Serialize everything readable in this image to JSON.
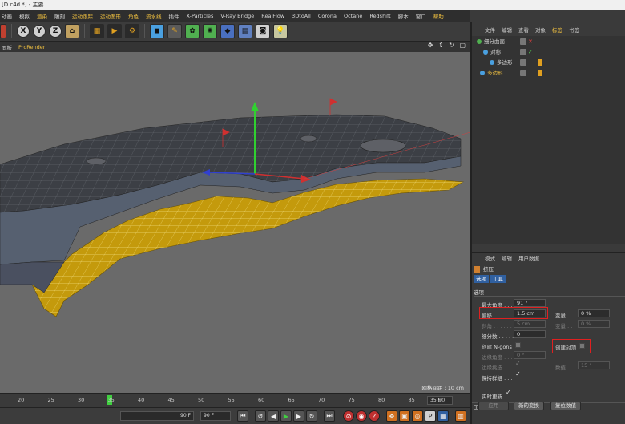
{
  "window": {
    "title": "[D.c4d *] - 主要"
  },
  "menu": [
    {
      "label": "动画",
      "hl": false
    },
    {
      "label": "模拟",
      "hl": false
    },
    {
      "label": "渲染",
      "hl": true
    },
    {
      "label": "雕刻",
      "hl": false
    },
    {
      "label": "运动跟踪",
      "hl": true
    },
    {
      "label": "运动图形",
      "hl": true
    },
    {
      "label": "角色",
      "hl": true
    },
    {
      "label": "流水线",
      "hl": true
    },
    {
      "label": "插件",
      "hl": false
    },
    {
      "label": "X-Particles",
      "hl": false
    },
    {
      "label": "V-Ray Bridge",
      "hl": false
    },
    {
      "label": "RealFlow",
      "hl": false
    },
    {
      "label": "3DtoAll",
      "hl": false
    },
    {
      "label": "Corona",
      "hl": false
    },
    {
      "label": "Octane",
      "hl": false
    },
    {
      "label": "Redshift",
      "hl": false
    },
    {
      "label": "脚本",
      "hl": false
    },
    {
      "label": "窗口",
      "hl": false
    },
    {
      "label": "帮助",
      "hl": true
    }
  ],
  "toolbar": {
    "axis_x": "X",
    "axis_y": "Y",
    "axis_z": "Z",
    "icons": [
      "coordinate-icon",
      "render-view-icon",
      "render-picture-viewer-icon",
      "render-settings-icon",
      "cube-icon",
      "pen-icon",
      "subdivision-icon",
      "cloner-icon",
      "deformer-icon",
      "floor-icon",
      "camera-icon",
      "light-icon"
    ]
  },
  "viewport": {
    "menu_left": "面板",
    "menu_pro": "ProRender",
    "nav_icons": "✥ ⇕ ↻ ▢",
    "grid_label": "网格间距 : 10 cm"
  },
  "timeline": {
    "ticks": [
      "20",
      "25",
      "30",
      "35",
      "40",
      "45",
      "50",
      "55",
      "60",
      "65",
      "70",
      "75",
      "80",
      "85",
      "90"
    ],
    "end_frame": "35 F"
  },
  "transport": {
    "frame_a": "90 F",
    "frame_b": "90 F"
  },
  "object_manager": {
    "tabs": [
      {
        "label": "文件",
        "hl": false
      },
      {
        "label": "编辑",
        "hl": false
      },
      {
        "label": "查看",
        "hl": false
      },
      {
        "label": "对象",
        "hl": false
      },
      {
        "label": "标签",
        "hl": true
      },
      {
        "label": "书签",
        "hl": false
      }
    ],
    "objects": [
      {
        "name": "细分曲面",
        "indent": 0,
        "color": "#d0d0d0",
        "icon_color": "#50b050",
        "state": "✕",
        "state_color": "#e04040",
        "tag": false
      },
      {
        "name": "对称",
        "indent": 8,
        "color": "#d0d0d0",
        "icon_color": "#4aa0e0",
        "state": "✓",
        "state_color": "#50c050",
        "tag": false
      },
      {
        "name": "多边形",
        "indent": 16,
        "color": "#d0d0d0",
        "icon_color": "#4aa0e0",
        "state": "",
        "state_color": "#cfcfcf",
        "tag": true
      },
      {
        "name": "多边形",
        "indent": 4,
        "color": "#f0c040",
        "icon_color": "#4aa0e0",
        "state": "",
        "state_color": "#cfcfcf",
        "tag": true
      }
    ]
  },
  "attributes": {
    "tabs": [
      "模式",
      "编辑",
      "用户数据"
    ],
    "object_name": "挤压",
    "sub_tabs": [
      "选项",
      "工具"
    ],
    "section": "选项",
    "max_angle_label": "最大角度 . . . . . . .",
    "max_angle_value": "91 °",
    "offset_label": "偏移 . . . . . . . . .",
    "offset_value": "1.5 cm",
    "variation_label": "变量 . . .",
    "variation_value": "0 %",
    "bevel_label": "斜角 . . . . . . . .",
    "bevel_value": "5 cm",
    "variation2_label": "变量 . . .",
    "variation2_value": "0 %",
    "subdiv_label": "细分数 . . . . . . .",
    "subdiv_value": "0",
    "ngons_label": "创建 N-gons",
    "caps_label": "创建封顶",
    "edge_angle_label": "边缘角度 . . . .",
    "edge_angle_value": "0 °",
    "edge_sel_label": "边缘挑选 . . .",
    "value_label": "数值",
    "value_value": "15 °",
    "keep_groups_label": "保持群组 . . ."
  },
  "tools": {
    "section": "工具",
    "realtime_label": "实时更新",
    "apply_label": "应用",
    "new_transform_label": "新的变换",
    "reset_label": "复位数值"
  }
}
